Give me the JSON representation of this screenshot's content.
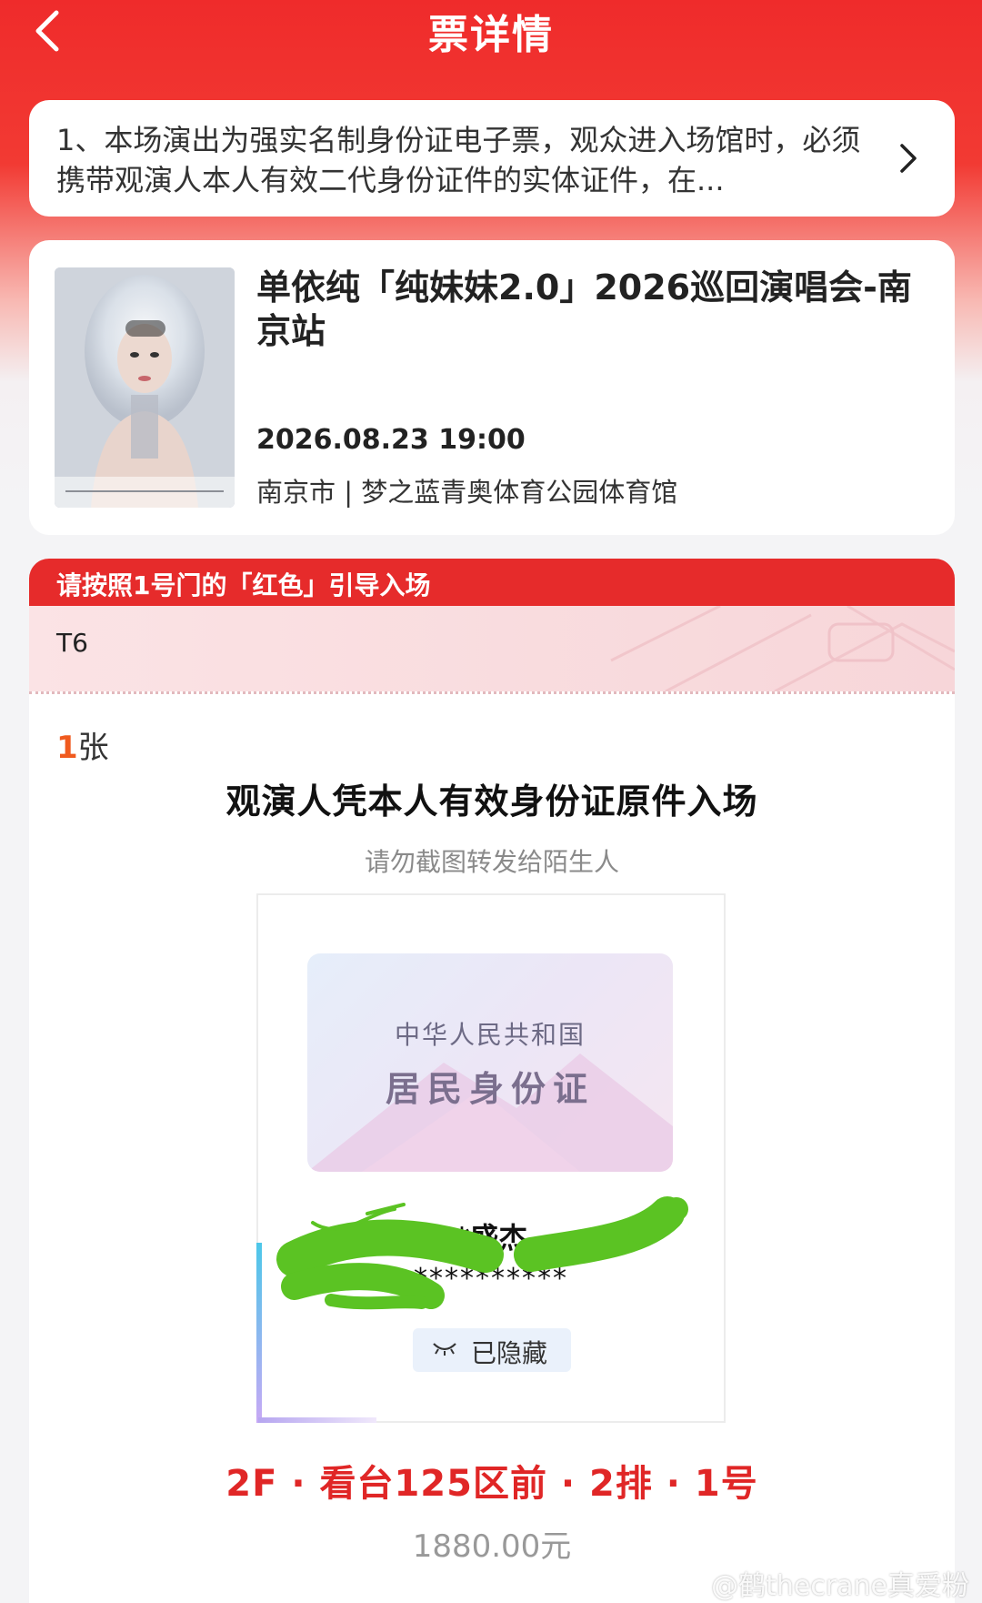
{
  "header": {
    "title": "票详情",
    "back_icon": "chevron-left-icon"
  },
  "notice": {
    "text": "1、本场演出为强实名制身份证电子票，观众进入场馆时，必须携带观演人本人有效二代身份证件的实体证件，在...",
    "icon": "chevron-right-icon"
  },
  "event": {
    "title": "单依纯「纯妹妹2.0」2026巡回演唱会-南京站",
    "datetime": "2026.08.23 19:00",
    "venue": "南京市 | 梦之蓝青奥体育公园体育馆"
  },
  "ticket": {
    "guide": "请按照1号门的「红色」引导入场",
    "gate": "T6",
    "quantity_num": "1",
    "quantity_unit": "张",
    "entry_title": "观演人凭本人有效身份证原件入场",
    "entry_sub": "请勿截图转发给陌生人",
    "id_card": {
      "country": "中华人民共和国",
      "type": "居民身份证"
    },
    "holder_name": "*盛杰",
    "holder_id": "**********",
    "hidden_label": "已隐藏",
    "seat": "2F · 看台125区前 · 2排 · 1号",
    "price": "1880.00元"
  },
  "watermark": "@鹤thecrane真爱粉",
  "colors": {
    "brand_red": "#e62b2b",
    "seat_red": "#e02626",
    "qty_orange": "#f05a1e"
  }
}
